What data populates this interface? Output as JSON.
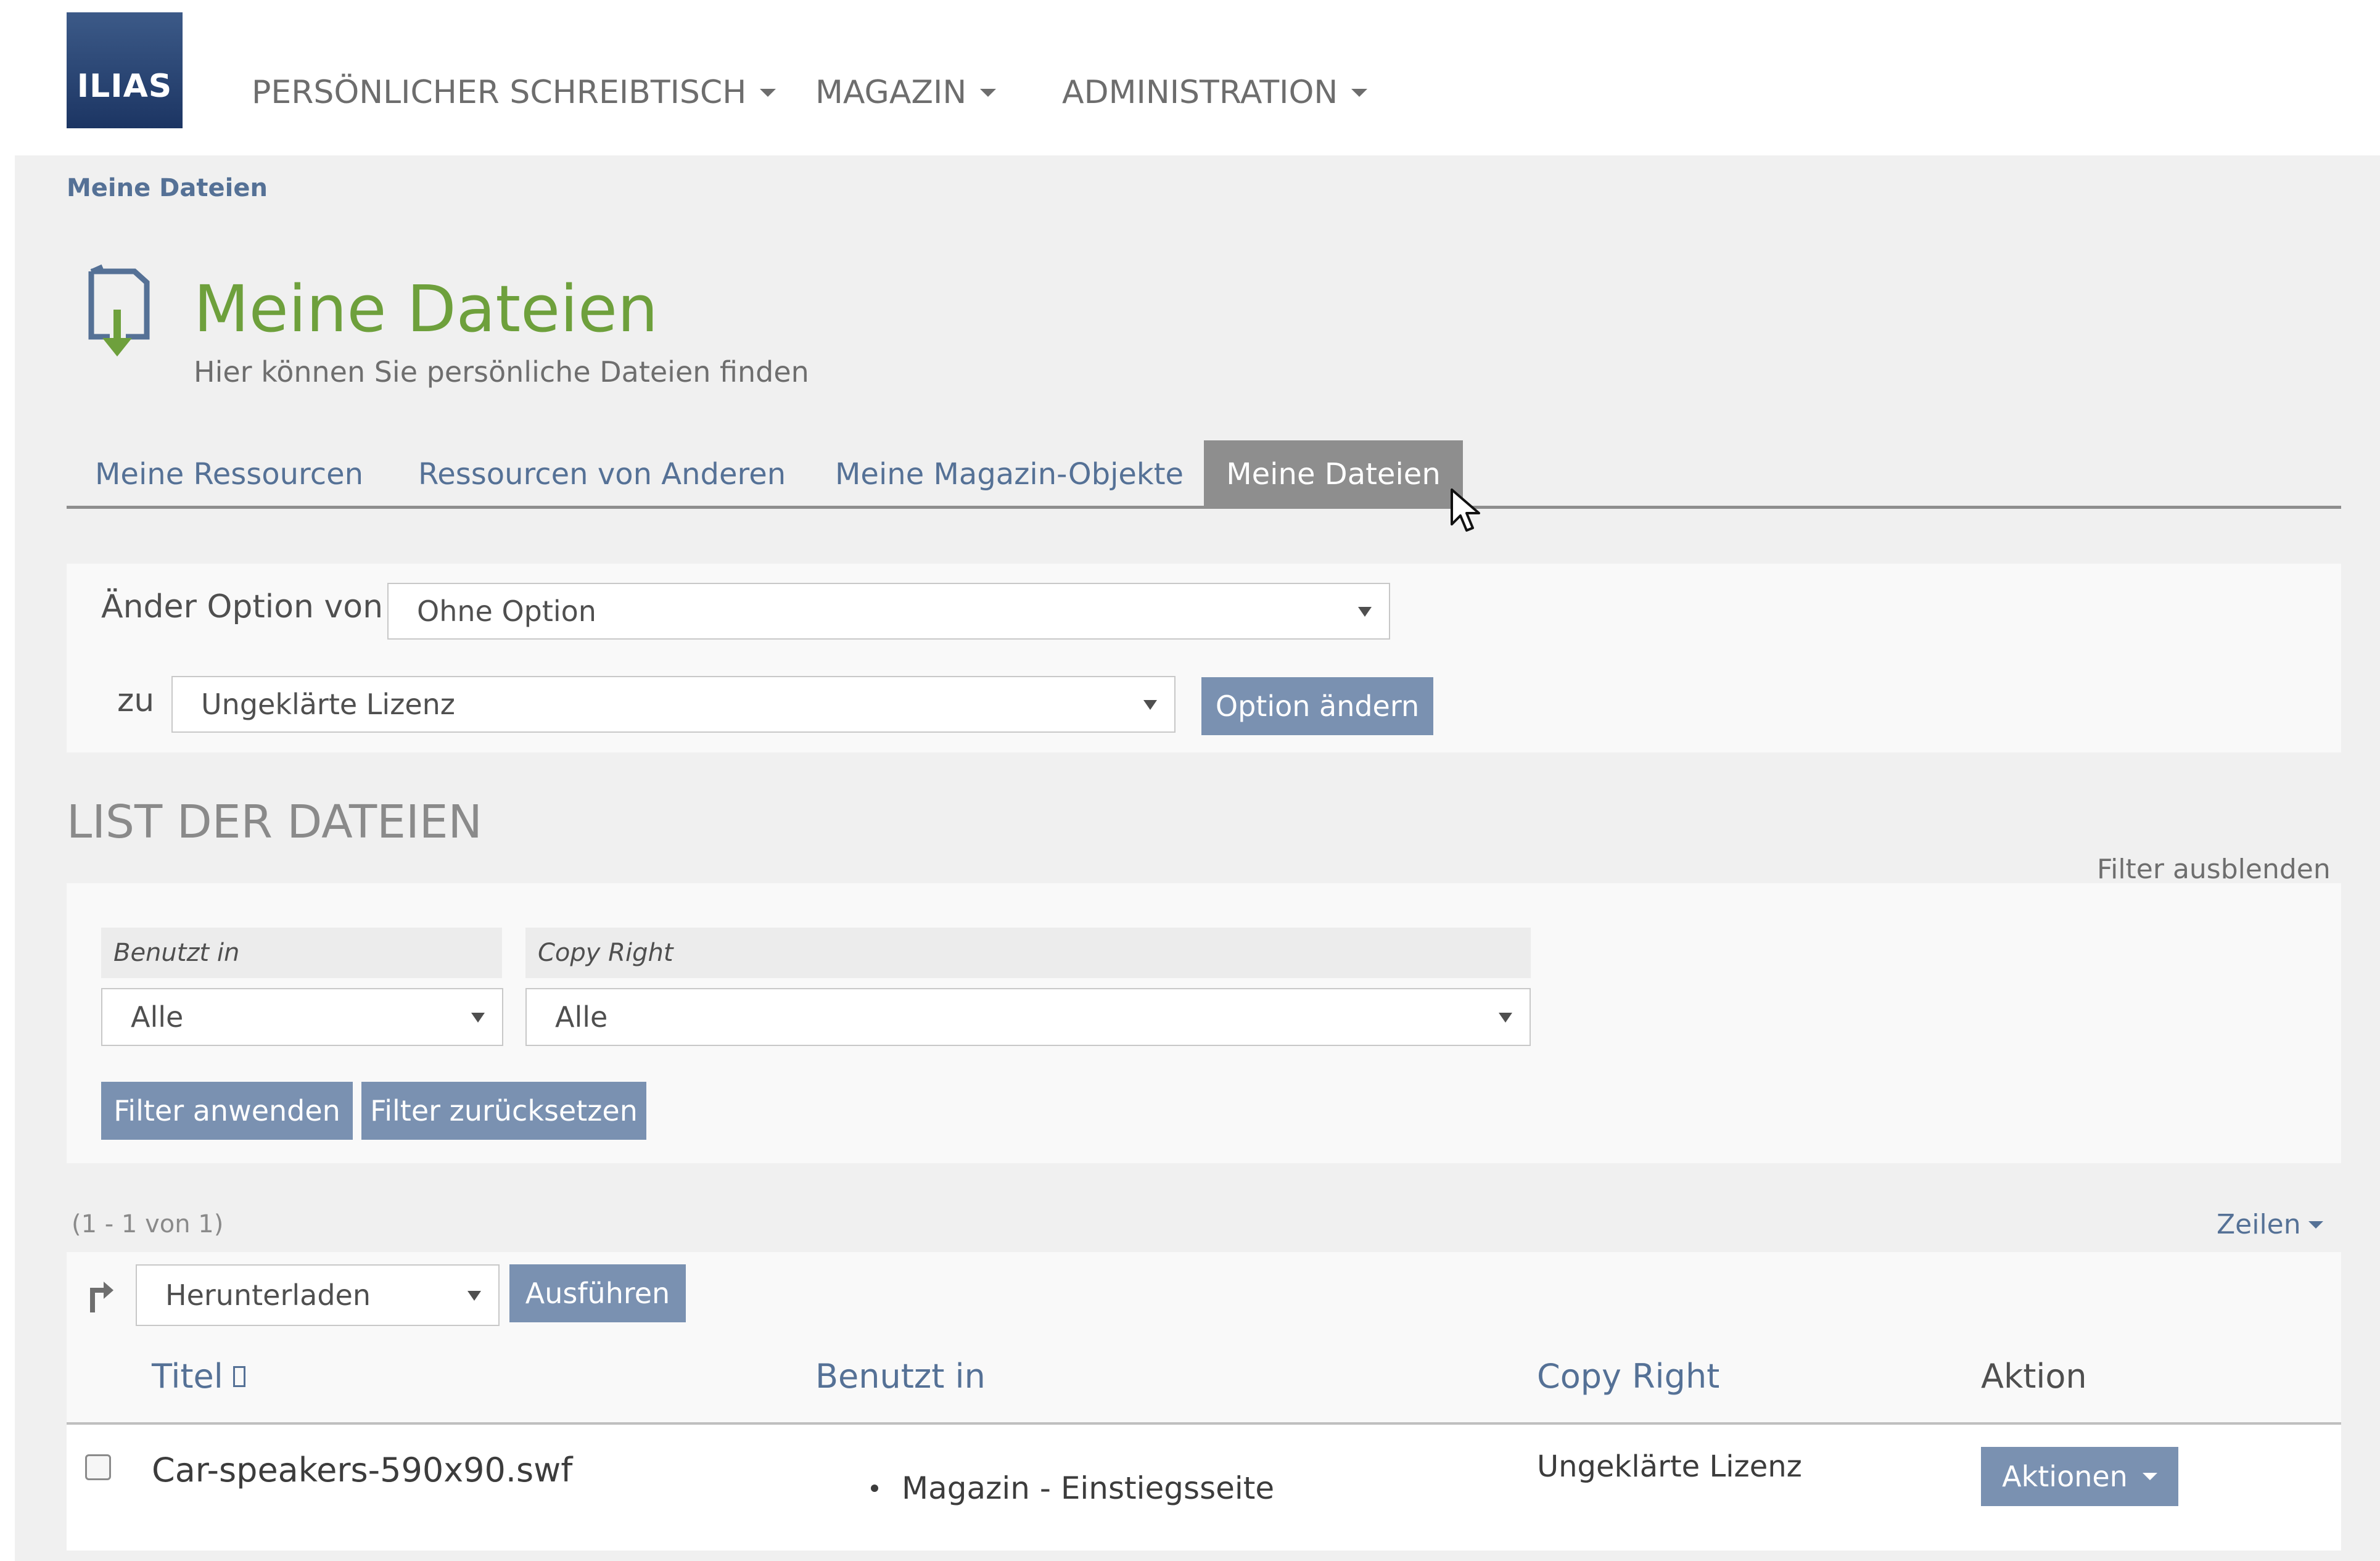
{
  "header": {
    "logo_text": "ILIAS",
    "nav": [
      {
        "label": "PERSÖNLICHER SCHREIBTISCH"
      },
      {
        "label": "MAGAZIN"
      },
      {
        "label": "ADMINISTRATION"
      }
    ]
  },
  "breadcrumb": "Meine Dateien",
  "page": {
    "icon": "file-download-icon",
    "title": "Meine Dateien",
    "subtitle": "Hier können Sie persönliche Dateien finden"
  },
  "tabs": [
    {
      "label": "Meine Ressourcen",
      "active": false
    },
    {
      "label": "Ressourcen von Anderen",
      "active": false
    },
    {
      "label": "Meine Magazin-Objekte",
      "active": false
    },
    {
      "label": "Meine Dateien",
      "active": true
    }
  ],
  "option_form": {
    "from_label": "Änder Option von",
    "from_value": "Ohne Option",
    "to_label": "zu",
    "to_value": "Ungeklärte Lizenz",
    "submit_label": "Option ändern"
  },
  "list": {
    "title": "LIST DER DATEIEN",
    "hide_filter_label": "Filter ausblenden",
    "filters": {
      "used_in_label": "Benutzt in",
      "used_in_value": "Alle",
      "copyright_label": "Copy Right",
      "copyright_value": "Alle",
      "apply_label": "Filter anwenden",
      "reset_label": "Filter zurücksetzen"
    },
    "count_text": "(1 - 1 von 1)",
    "rows_label": "Zeilen",
    "bulk_action_value": "Herunterladen",
    "bulk_execute_label": "Ausführen",
    "columns": [
      "Titel",
      "Benutzt in",
      "Copy Right",
      "Aktion"
    ],
    "rows": [
      {
        "title": "Car-speakers-590x90.swf",
        "used_in": "Magazin - Einstiegsseite",
        "copyright": "Ungeklärte Lizenz",
        "action_label": "Aktionen"
      }
    ]
  },
  "colors": {
    "brand": "#1c3563",
    "title_green": "#6ea03c",
    "link": "#557196",
    "button": "#7a91b1",
    "tab_active": "#8e8e8e"
  }
}
